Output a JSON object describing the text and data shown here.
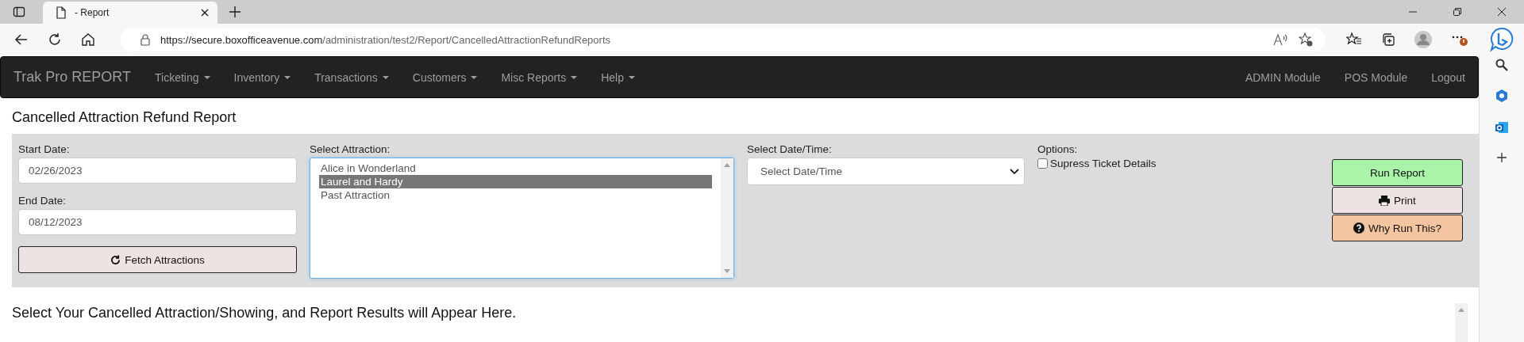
{
  "browser": {
    "tabs": [
      {
        "title": "- Report",
        "selected": true
      }
    ],
    "url_host": "https://secure.boxofficeavenue.com",
    "url_path": "/administration/test2/Report/CancelledAttractionRefundReports"
  },
  "navbar": {
    "brand": "Trak Pro REPORT",
    "menus": [
      "Ticketing",
      "Inventory",
      "Transactions",
      "Customers",
      "Misc Reports",
      "Help"
    ],
    "links": [
      "ADMIN Module",
      "POS Module",
      "Logout"
    ]
  },
  "page": {
    "title": "Cancelled Attraction Refund Report",
    "start_date": {
      "label": "Start Date:",
      "value": "02/26/2023"
    },
    "end_date": {
      "label": "End Date:",
      "value": "08/12/2023"
    },
    "fetch_button": "Fetch Attractions",
    "attraction": {
      "label": "Select Attraction:",
      "options": [
        {
          "label": "Alice in Wonderland",
          "selected": false
        },
        {
          "label": "Laurel and Hardy",
          "selected": true
        },
        {
          "label": "Past Attraction",
          "selected": false
        }
      ]
    },
    "date_time": {
      "label": "Select Date/Time:",
      "placeholder": "Select Date/Time"
    },
    "options": {
      "label": "Options:",
      "checkboxes": [
        {
          "label": "Supress Ticket Details",
          "checked": false
        }
      ]
    },
    "buttons": [
      {
        "label": "Run Report",
        "kind": "run"
      },
      {
        "label": "Print",
        "kind": "print"
      },
      {
        "label": "Why Run This?",
        "kind": "help"
      }
    ],
    "message": "Select Your Cancelled Attraction/Showing, and Report Results will Appear Here."
  }
}
